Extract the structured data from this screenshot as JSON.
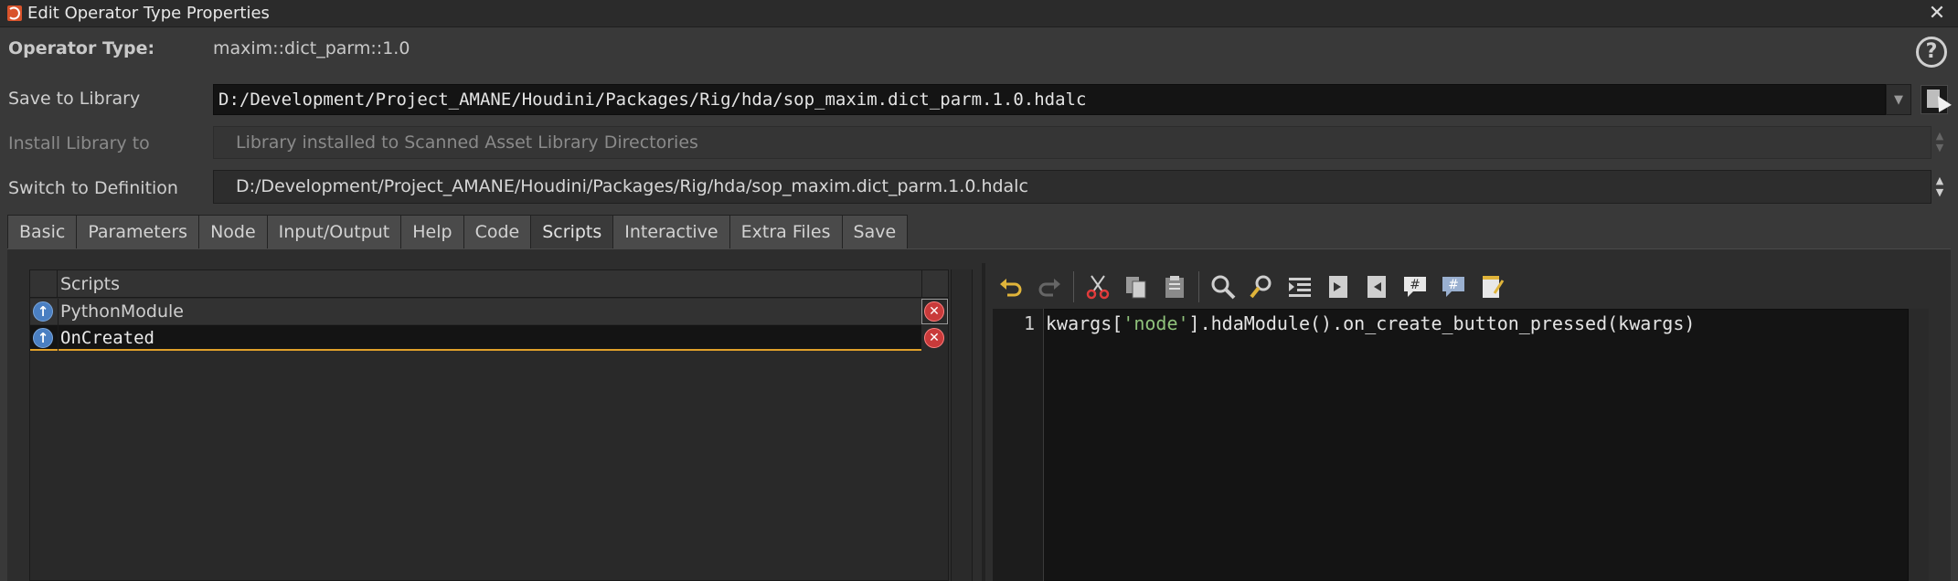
{
  "window": {
    "title": "Edit Operator Type Properties",
    "close_label": "✕"
  },
  "form": {
    "operator_type_label": "Operator Type:",
    "operator_type_value": "maxim::dict_parm::1.0",
    "save_to_library_label": "Save to Library",
    "save_to_library_value": "D:/Development/Project_AMANE/Houdini/Packages/Rig/hda/sop_maxim.dict_parm.1.0.hdalc",
    "install_library_label": "Install Library to",
    "install_library_value": "Library installed to Scanned Asset Library Directories",
    "switch_definition_label": "Switch to Definition",
    "switch_definition_value": "D:/Development/Project_AMANE/Houdini/Packages/Rig/hda/sop_maxim.dict_parm.1.0.hdalc",
    "help_label": "?"
  },
  "tabs": [
    {
      "label": "Basic",
      "active": false
    },
    {
      "label": "Parameters",
      "active": false
    },
    {
      "label": "Node",
      "active": false
    },
    {
      "label": "Input/Output",
      "active": false
    },
    {
      "label": "Help",
      "active": false
    },
    {
      "label": "Code",
      "active": false
    },
    {
      "label": "Scripts",
      "active": true
    },
    {
      "label": "Interactive",
      "active": false
    },
    {
      "label": "Extra Files",
      "active": false
    },
    {
      "label": "Save",
      "active": false
    }
  ],
  "scripts_list": {
    "header": "Scripts",
    "items": [
      {
        "name": "PythonModule",
        "selected": false
      },
      {
        "name": "OnCreated",
        "selected": true
      }
    ]
  },
  "editor": {
    "toolbar": [
      "undo-icon",
      "redo-icon",
      "cut-icon",
      "copy-icon",
      "paste-icon",
      "find-icon",
      "find-replace-icon",
      "indent-icon",
      "comment-in-icon",
      "comment-out-icon",
      "hash-comment-icon",
      "block-comment-icon",
      "notepad-icon"
    ],
    "line_number": "1",
    "code_before": "kwargs[",
    "code_string": "'node'",
    "code_after": "].hdaModule().on_create_button_pressed(kwargs)"
  },
  "colors": {
    "accent_selection": "#e0a02a",
    "arrow_button": "#4a7fc2",
    "delete_button": "#c93a3a",
    "string_literal": "#8fc27b"
  }
}
